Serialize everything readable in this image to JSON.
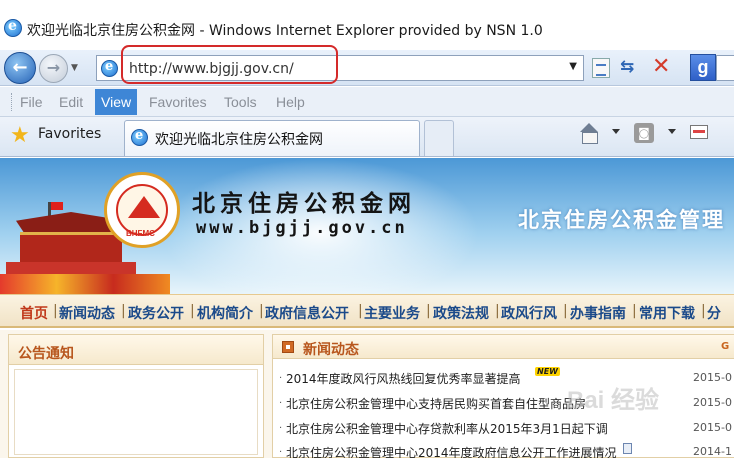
{
  "window": {
    "title": "欢迎光临北京住房公积金网 - Windows Internet Explorer provided by NSN 1.0"
  },
  "address_bar": {
    "url": "http://www.bjgjj.gov.cn/",
    "search_provider_letter": "g"
  },
  "menu": {
    "items": [
      {
        "label": "File"
      },
      {
        "label": "Edit"
      },
      {
        "label": "View"
      },
      {
        "label": "Favorites"
      },
      {
        "label": "Tools"
      },
      {
        "label": "Help"
      }
    ],
    "active_item": "View"
  },
  "favorites_bar": {
    "favorites_label": "Favorites",
    "tab_label": "欢迎光临北京住房公积金网"
  },
  "banner": {
    "site_title": "北京住房公积金网",
    "site_url": "www.bjgjj.gov.cn",
    "right_title": "北京住房公积金管理",
    "logo_text": "BHFMC"
  },
  "site_nav": {
    "items": [
      "首页",
      "新闻动态",
      "政务公开",
      "机构简介",
      "政府信息公开",
      "主要业务",
      "政策法规",
      "政风行风",
      "办事指南",
      "常用下载",
      "分"
    ]
  },
  "notice_panel": {
    "title": "公告通知"
  },
  "news_panel": {
    "title": "新闻动态",
    "more_icon": "G",
    "items": [
      {
        "text": "2014年度政风行风热线回复优秀率显著提高",
        "date": "2015-0",
        "badge": "NEW"
      },
      {
        "text": "北京住房公积金管理中心支持居民购买首套自住型商品房",
        "date": "2015-0"
      },
      {
        "text": "北京住房公积金管理中心存贷款利率从2015年3月1日起下调",
        "date": "2015-0"
      },
      {
        "text": "北京住房公积金管理中心2014年度政府信息公开工作进展情况",
        "date": "2014-1"
      }
    ]
  },
  "watermark": "Bai 经验",
  "colors": {
    "highlight": "#d42a2a",
    "menu_active": "#3e86d6",
    "nav_text": "#1b4a8a",
    "nav_home": "#c0391b",
    "section_title": "#b8561d"
  }
}
